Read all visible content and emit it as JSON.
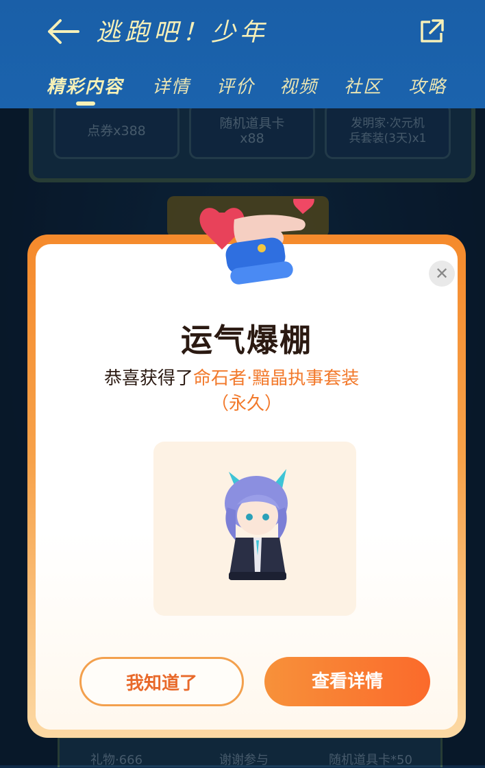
{
  "header": {
    "title": "逃跑吧！少年",
    "back_icon": "arrow-left-icon",
    "share_icon": "share-external-icon",
    "tabs": [
      {
        "label": "精彩内容",
        "active": true
      },
      {
        "label": "详情",
        "active": false
      },
      {
        "label": "评价",
        "active": false
      },
      {
        "label": "视频",
        "active": false
      },
      {
        "label": "社区",
        "active": false
      },
      {
        "label": "攻略",
        "active": false
      }
    ]
  },
  "background": {
    "rewards_top": [
      "点券x388",
      "随机道具卡\nx88",
      "发明家·次元机\n兵套装(3天)x1"
    ],
    "rewards_bottom": [
      "礼物·666",
      "谢谢参与",
      "随机道具卡*50"
    ]
  },
  "modal": {
    "title": "运气爆棚",
    "message_prefix": "恭喜获得了",
    "prize_name": "命石者·黯晶执事套装",
    "prize_duration": "（永久）",
    "close_icon": "close-icon",
    "dismiss_label": "我知道了",
    "detail_label": "查看详情"
  },
  "colors": {
    "header_bg": "#1b63ad",
    "header_text": "#f6f0b8",
    "accent_orange": "#f2792b",
    "modal_frame": "#f58a2c"
  }
}
